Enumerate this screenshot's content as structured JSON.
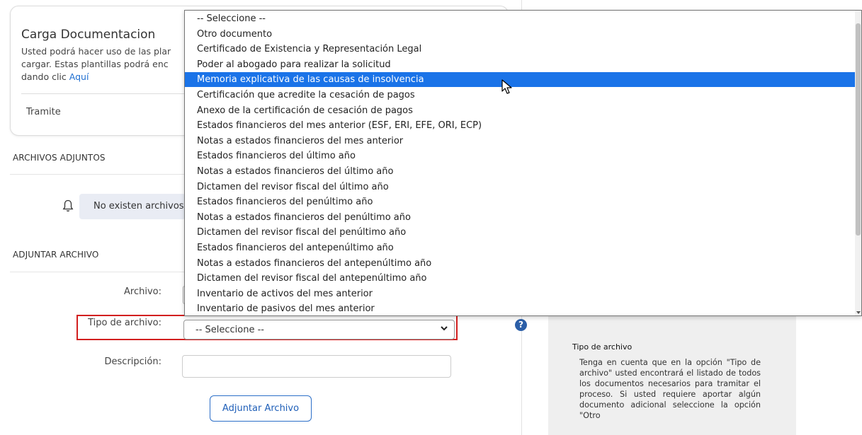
{
  "card": {
    "title": "Carga Documentacion",
    "desc_line1": "Usted podrá hacer uso de las plar",
    "desc_line2": "cargar. Estas plantillas podrá enc",
    "desc_line3_prefix": "dando clic ",
    "desc_link": "Aquí",
    "tramite_label": "Tramite"
  },
  "attachments": {
    "section_title": "ARCHIVOS ADJUNTOS",
    "empty_message": "No existen archivos"
  },
  "upload": {
    "section_title": "ADJUNTAR ARCHIVO",
    "file_label": "Archivo:",
    "type_label": "Tipo de archivo:",
    "type_selected": "-- Seleccione --",
    "description_label": "Descripción:",
    "submit_label": "Adjuntar Archivo"
  },
  "dropdown": {
    "selected_index": 4,
    "options": [
      "-- Seleccione --",
      "Otro documento",
      "Certificado de Existencia y Representación Legal",
      "Poder al abogado para realizar la solicitud",
      "Memoria explicativa de las causas de insolvencia",
      "Certificación que acredite la cesación de pagos",
      "Anexo de la certificación de cesación de pagos",
      "Estados financieros del mes anterior (ESF, ERI, EFE, ORI, ECP)",
      "Notas a estados financieros del mes anterior",
      "Estados financieros del último año",
      "Notas a estados financieros del último año",
      "Dictamen del revisor fiscal del último año",
      "Estados financieros del penúltimo año",
      "Notas a estados financieros del penúltimo año",
      "Dictamen del revisor fiscal del penúltimo año",
      "Estados financieros del antepenúltimo año",
      "Notas a estados financieros del antepenúltimo año",
      "Dictamen del revisor fiscal del antepenúltimo año",
      "Inventario de activos del mes anterior",
      "Inventario de pasivos del mes anterior"
    ]
  },
  "help": {
    "icon_glyph": "?",
    "title": "Tipo de archivo",
    "text": "Tenga en cuenta que en la opción \"Tipo de archivo\" usted encontrará el listado de todos los documentos necesarios para tramitar el proceso. Si usted requiere aportar algún documento adicional seleccione la opción \"Otro"
  },
  "colors": {
    "accent": "#1a73e8",
    "highlight_border": "#d21f1f",
    "link": "#1f6fd1"
  }
}
